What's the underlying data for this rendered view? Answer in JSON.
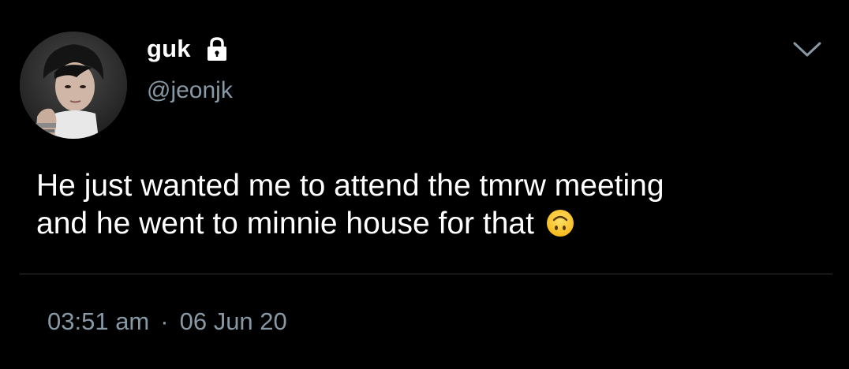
{
  "tweet": {
    "display_name": "guk",
    "handle": "@jeonjk",
    "text_line1": "He just wanted me to attend the tmrw meeting",
    "text_line2": "and he went to minnie house for that",
    "emoji": "upside-down-face",
    "time": "03:51 am",
    "separator": "·",
    "date": "06 Jun 20",
    "protected": true
  },
  "icons": {
    "lock": "lock-icon",
    "menu": "chevron-down-icon",
    "emoji": "upside-down-face-emoji"
  },
  "colors": {
    "background": "#000000",
    "primary_text": "#ffffff",
    "secondary_text": "#8899a6",
    "divider": "#2f3336"
  }
}
